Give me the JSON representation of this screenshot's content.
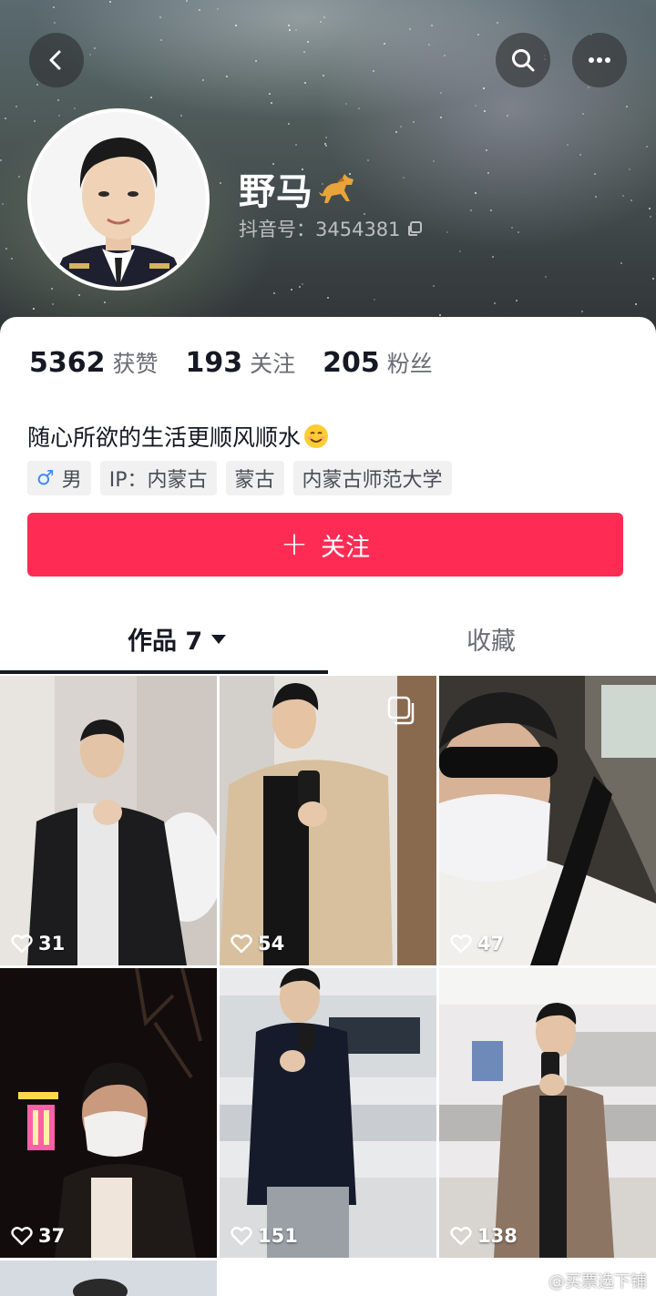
{
  "profile": {
    "nickname": "野马",
    "douyin_id": "抖音号：3454381"
  },
  "stats": [
    {
      "value": "5362",
      "label": "获赞"
    },
    {
      "value": "193",
      "label": "关注"
    },
    {
      "value": "205",
      "label": "粉丝"
    }
  ],
  "bio": "随心所欲的生活更顺风顺水",
  "tags": {
    "gender": "男",
    "ip": "IP：内蒙古",
    "region": "蒙古",
    "school": "内蒙古师范大学"
  },
  "follow_label": "关注",
  "tabs": {
    "works": "作品 7",
    "favorites": "收藏"
  },
  "posts": [
    {
      "likes": "31"
    },
    {
      "likes": "54"
    },
    {
      "likes": "47"
    },
    {
      "likes": "37"
    },
    {
      "likes": "151"
    },
    {
      "likes": "138"
    }
  ],
  "watermark": "@买票选下铺",
  "colors": {
    "accent": "#fe2c55",
    "text_primary": "#161823",
    "text_secondary": "#6b6d75",
    "tag_bg": "#f1f1f2"
  }
}
